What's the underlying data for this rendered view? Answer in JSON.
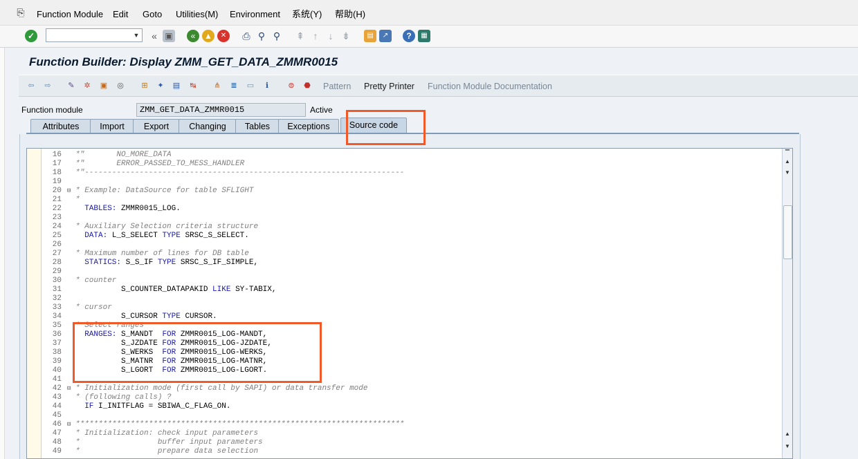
{
  "menubar": {
    "items": [
      "Function Module",
      "Edit",
      "Goto",
      "Utilities(M)",
      "Environment",
      "系统(Y)",
      "帮助(H)"
    ]
  },
  "std_toolbar": {
    "command_field_value": ""
  },
  "title": "Function Builder: Display ZMM_GET_DATA_ZMMR0015",
  "app_toolbar": {
    "pattern_label": "Pattern",
    "pretty_printer_label": "Pretty Printer",
    "fm_doc_label": "Function Module Documentation"
  },
  "header": {
    "function_module_label": "Function module",
    "function_module_value": "ZMM_GET_DATA_ZMMR0015",
    "status": "Active"
  },
  "tabs": [
    "Attributes",
    "Import",
    "Export",
    "Changing",
    "Tables",
    "Exceptions",
    "Source code"
  ],
  "active_tab": "Source code",
  "code": [
    {
      "n": "16",
      "fold": false,
      "segs": [
        [
          "cm",
          "*\"       NO_MORE_DATA"
        ]
      ]
    },
    {
      "n": "17",
      "fold": false,
      "segs": [
        [
          "cm",
          "*\"       ERROR_PASSED_TO_MESS_HANDLER"
        ]
      ]
    },
    {
      "n": "18",
      "fold": false,
      "segs": [
        [
          "cm",
          "*\"----------------------------------------------------------------------"
        ]
      ]
    },
    {
      "n": "19",
      "fold": false,
      "segs": []
    },
    {
      "n": "20",
      "fold": true,
      "segs": [
        [
          "cm",
          "* Example: DataSource for table SFLIGHT"
        ]
      ]
    },
    {
      "n": "21",
      "fold": false,
      "segs": [
        [
          "cm",
          "*"
        ]
      ]
    },
    {
      "n": "22",
      "fold": false,
      "segs": [
        [
          "kw",
          "  TABLES: "
        ],
        [
          "id",
          "ZMMR0015_LOG."
        ]
      ]
    },
    {
      "n": "23",
      "fold": false,
      "segs": []
    },
    {
      "n": "24",
      "fold": false,
      "segs": [
        [
          "cm",
          "* Auxiliary Selection criteria structure"
        ]
      ]
    },
    {
      "n": "25",
      "fold": false,
      "segs": [
        [
          "kw",
          "  DATA: "
        ],
        [
          "id",
          "L_S_SELECT "
        ],
        [
          "kw",
          "TYPE "
        ],
        [
          "id",
          "SRSC_S_SELECT."
        ]
      ]
    },
    {
      "n": "26",
      "fold": false,
      "segs": []
    },
    {
      "n": "27",
      "fold": false,
      "segs": [
        [
          "cm",
          "* Maximum number of lines for DB table"
        ]
      ]
    },
    {
      "n": "28",
      "fold": false,
      "segs": [
        [
          "kw",
          "  STATICS: "
        ],
        [
          "id",
          "S_S_IF "
        ],
        [
          "kw",
          "TYPE "
        ],
        [
          "id",
          "SRSC_S_IF_SIMPLE,"
        ]
      ]
    },
    {
      "n": "29",
      "fold": false,
      "segs": []
    },
    {
      "n": "30",
      "fold": false,
      "segs": [
        [
          "cm",
          "* counter"
        ]
      ]
    },
    {
      "n": "31",
      "fold": false,
      "segs": [
        [
          "id",
          "          S_COUNTER_DATAPAKID "
        ],
        [
          "kw",
          "LIKE "
        ],
        [
          "id",
          "SY-TABIX,"
        ]
      ]
    },
    {
      "n": "32",
      "fold": false,
      "segs": []
    },
    {
      "n": "33",
      "fold": false,
      "segs": [
        [
          "cm",
          "* cursor"
        ]
      ]
    },
    {
      "n": "34",
      "fold": false,
      "segs": [
        [
          "id",
          "          S_CURSOR "
        ],
        [
          "kw",
          "TYPE "
        ],
        [
          "id",
          "CURSOR."
        ]
      ]
    },
    {
      "n": "35",
      "fold": false,
      "segs": [
        [
          "cm",
          "* Select ranges"
        ]
      ]
    },
    {
      "n": "36",
      "fold": false,
      "segs": [
        [
          "kw",
          "  RANGES: "
        ],
        [
          "id",
          "S_MANDT  "
        ],
        [
          "kw",
          "FOR "
        ],
        [
          "id",
          "ZMMR0015_LOG-MANDT,"
        ]
      ]
    },
    {
      "n": "37",
      "fold": false,
      "segs": [
        [
          "id",
          "          S_JZDATE "
        ],
        [
          "kw",
          "FOR "
        ],
        [
          "id",
          "ZMMR0015_LOG-JZDATE,"
        ]
      ]
    },
    {
      "n": "38",
      "fold": false,
      "segs": [
        [
          "id",
          "          S_WERKS  "
        ],
        [
          "kw",
          "FOR "
        ],
        [
          "id",
          "ZMMR0015_LOG-WERKS,"
        ]
      ]
    },
    {
      "n": "39",
      "fold": false,
      "segs": [
        [
          "id",
          "          S_MATNR  "
        ],
        [
          "kw",
          "FOR "
        ],
        [
          "id",
          "ZMMR0015_LOG-MATNR,"
        ]
      ]
    },
    {
      "n": "40",
      "fold": false,
      "segs": [
        [
          "id",
          "          S_LGORT  "
        ],
        [
          "kw",
          "FOR "
        ],
        [
          "id",
          "ZMMR0015_LOG-LGORT."
        ]
      ]
    },
    {
      "n": "41",
      "fold": false,
      "segs": []
    },
    {
      "n": "42",
      "fold": true,
      "segs": [
        [
          "cm",
          "* Initialization mode (first call by SAPI) or data transfer mode"
        ]
      ]
    },
    {
      "n": "43",
      "fold": false,
      "segs": [
        [
          "cm",
          "* (following calls) ?"
        ]
      ]
    },
    {
      "n": "44",
      "fold": false,
      "segs": [
        [
          "kw",
          "  IF "
        ],
        [
          "id",
          "I_INITFLAG = SBIWA_C_FLAG_ON."
        ]
      ]
    },
    {
      "n": "45",
      "fold": false,
      "segs": []
    },
    {
      "n": "46",
      "fold": true,
      "segs": [
        [
          "cm",
          "************************************************************************"
        ]
      ]
    },
    {
      "n": "47",
      "fold": false,
      "segs": [
        [
          "cm",
          "* Initialization: check input parameters"
        ]
      ]
    },
    {
      "n": "48",
      "fold": false,
      "segs": [
        [
          "cm",
          "*                 buffer input parameters"
        ]
      ]
    },
    {
      "n": "49",
      "fold": false,
      "segs": [
        [
          "cm",
          "*                 prepare data selection"
        ]
      ]
    }
  ],
  "colors": {
    "annotation": "#f05a28",
    "keyword": "#1a1aa6",
    "comment": "#7f7f7f"
  }
}
